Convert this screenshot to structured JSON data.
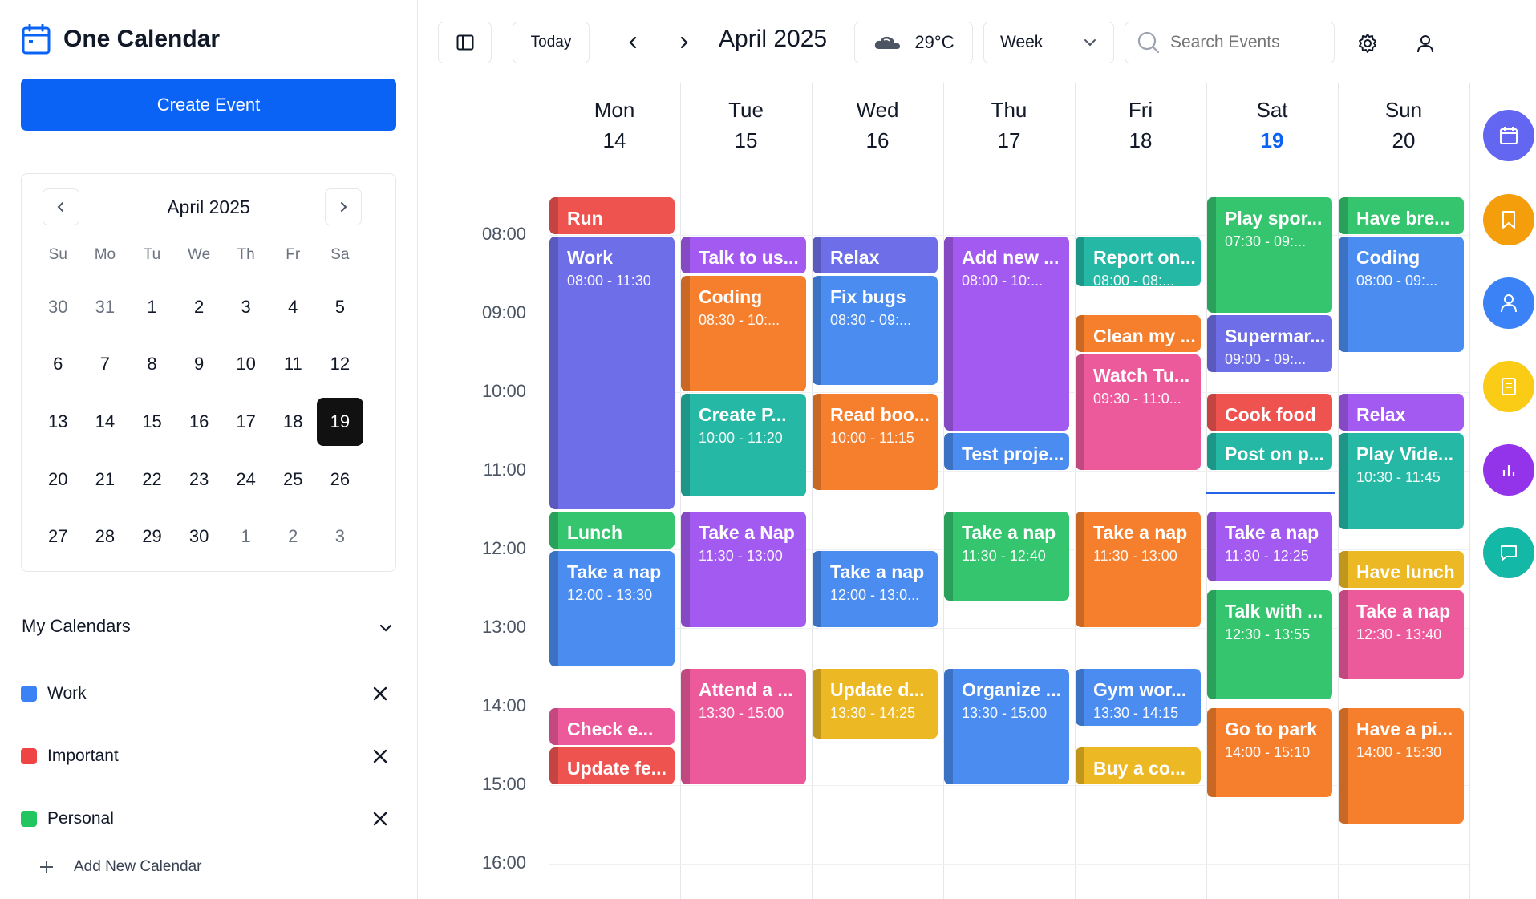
{
  "app": {
    "title": "One Calendar",
    "create_label": "Create Event"
  },
  "mini_calendar": {
    "title": "April 2025",
    "dow": [
      "Su",
      "Mo",
      "Tu",
      "We",
      "Th",
      "Fr",
      "Sa"
    ],
    "days": [
      {
        "d": "30",
        "muted": true
      },
      {
        "d": "31",
        "muted": true
      },
      {
        "d": "1"
      },
      {
        "d": "2"
      },
      {
        "d": "3"
      },
      {
        "d": "4"
      },
      {
        "d": "5"
      },
      {
        "d": "6"
      },
      {
        "d": "7"
      },
      {
        "d": "8"
      },
      {
        "d": "9"
      },
      {
        "d": "10"
      },
      {
        "d": "11"
      },
      {
        "d": "12"
      },
      {
        "d": "13"
      },
      {
        "d": "14"
      },
      {
        "d": "15"
      },
      {
        "d": "16"
      },
      {
        "d": "17"
      },
      {
        "d": "18"
      },
      {
        "d": "19",
        "selected": true
      },
      {
        "d": "20"
      },
      {
        "d": "21"
      },
      {
        "d": "22"
      },
      {
        "d": "23"
      },
      {
        "d": "24"
      },
      {
        "d": "25"
      },
      {
        "d": "26"
      },
      {
        "d": "27"
      },
      {
        "d": "28"
      },
      {
        "d": "29"
      },
      {
        "d": "30"
      },
      {
        "d": "1",
        "muted": true
      },
      {
        "d": "2",
        "muted": true
      },
      {
        "d": "3",
        "muted": true
      }
    ]
  },
  "my_calendars": {
    "title": "My Calendars",
    "items": [
      {
        "label": "Work",
        "color": "#3b82f6"
      },
      {
        "label": "Important",
        "color": "#ef4444"
      },
      {
        "label": "Personal",
        "color": "#22c55e"
      }
    ],
    "add_label": "Add New Calendar"
  },
  "toolbar": {
    "today_label": "Today",
    "title": "April 2025",
    "weather": "29°C",
    "view": "Week",
    "search_placeholder": "Search Events"
  },
  "week": {
    "days": [
      {
        "name": "Mon",
        "num": "14"
      },
      {
        "name": "Tue",
        "num": "15"
      },
      {
        "name": "Wed",
        "num": "16"
      },
      {
        "name": "Thu",
        "num": "17"
      },
      {
        "name": "Fri",
        "num": "18"
      },
      {
        "name": "Sat",
        "num": "19",
        "today": true
      },
      {
        "name": "Sun",
        "num": "20"
      }
    ],
    "times": [
      "08:00",
      "09:00",
      "10:00",
      "11:00",
      "12:00",
      "13:00",
      "14:00",
      "15:00",
      "16:00"
    ],
    "events": [
      {
        "day": 0,
        "start": "07:30",
        "end": "08:00",
        "title": "Run",
        "color": "#ef5350"
      },
      {
        "day": 0,
        "start": "08:00",
        "end": "11:30",
        "title": "Work",
        "time": "08:00 - 11:30",
        "color": "#6e6ee8"
      },
      {
        "day": 0,
        "start": "11:30",
        "end": "12:00",
        "title": "Lunch",
        "color": "#34c56e"
      },
      {
        "day": 0,
        "start": "12:00",
        "end": "13:30",
        "title": "Take a nap",
        "time": "12:00 - 13:30",
        "color": "#4a8cf0"
      },
      {
        "day": 0,
        "start": "14:00",
        "end": "14:30",
        "title": "Check e...",
        "color": "#ec5a9c"
      },
      {
        "day": 0,
        "start": "14:30",
        "end": "15:00",
        "title": "Update fe...",
        "color": "#ef5350"
      },
      {
        "day": 1,
        "start": "08:00",
        "end": "08:30",
        "title": "Talk to us...",
        "color": "#a35af0"
      },
      {
        "day": 1,
        "start": "08:30",
        "end": "10:00",
        "title": "Coding",
        "time": "08:30 - 10:...",
        "color": "#f57f2c"
      },
      {
        "day": 1,
        "start": "10:00",
        "end": "11:20",
        "title": "Create P...",
        "time": "10:00 - 11:20",
        "color": "#25b8a5"
      },
      {
        "day": 1,
        "start": "11:30",
        "end": "13:00",
        "title": "Take a Nap",
        "time": "11:30 - 13:00",
        "color": "#a35af0"
      },
      {
        "day": 1,
        "start": "13:30",
        "end": "15:00",
        "title": "Attend a ...",
        "time": "13:30 - 15:00",
        "color": "#ec5a9c"
      },
      {
        "day": 2,
        "start": "08:00",
        "end": "08:30",
        "title": "Relax",
        "color": "#6e6ee8"
      },
      {
        "day": 2,
        "start": "08:30",
        "end": "09:55",
        "title": "Fix bugs",
        "time": "08:30 - 09:...",
        "color": "#4a8cf0"
      },
      {
        "day": 2,
        "start": "10:00",
        "end": "11:15",
        "title": "Read boo...",
        "time": "10:00 - 11:15",
        "color": "#f57f2c"
      },
      {
        "day": 2,
        "start": "12:00",
        "end": "13:00",
        "title": "Take a nap",
        "time": "12:00 - 13:0...",
        "color": "#4a8cf0"
      },
      {
        "day": 2,
        "start": "13:30",
        "end": "14:25",
        "title": "Update d...",
        "time": "13:30 - 14:25",
        "color": "#ecb823"
      },
      {
        "day": 3,
        "start": "08:00",
        "end": "10:30",
        "title": "Add new ...",
        "time": "08:00 - 10:...",
        "color": "#a35af0"
      },
      {
        "day": 3,
        "start": "10:30",
        "end": "11:00",
        "title": "Test proje...",
        "color": "#4a8cf0"
      },
      {
        "day": 3,
        "start": "11:30",
        "end": "12:40",
        "title": "Take a nap",
        "time": "11:30 - 12:40",
        "color": "#34c56e"
      },
      {
        "day": 3,
        "start": "13:30",
        "end": "15:00",
        "title": "Organize ...",
        "time": "13:30 - 15:00",
        "color": "#4a8cf0"
      },
      {
        "day": 4,
        "start": "08:00",
        "end": "08:40",
        "title": "Report on...",
        "time": "08:00 - 08:...",
        "color": "#25b8a5"
      },
      {
        "day": 4,
        "start": "09:00",
        "end": "09:30",
        "title": "Clean my ...",
        "color": "#f57f2c"
      },
      {
        "day": 4,
        "start": "09:30",
        "end": "11:00",
        "title": "Watch Tu...",
        "time": "09:30 - 11:0...",
        "color": "#ec5a9c"
      },
      {
        "day": 4,
        "start": "11:30",
        "end": "13:00",
        "title": "Take a nap",
        "time": "11:30 - 13:00",
        "color": "#f57f2c"
      },
      {
        "day": 4,
        "start": "13:30",
        "end": "14:15",
        "title": "Gym wor...",
        "time": "13:30 - 14:15",
        "color": "#4a8cf0"
      },
      {
        "day": 4,
        "start": "14:30",
        "end": "15:00",
        "title": "Buy a co...",
        "color": "#ecb823"
      },
      {
        "day": 5,
        "start": "07:30",
        "end": "09:00",
        "title": "Play spor...",
        "time": "07:30 - 09:...",
        "color": "#34c56e"
      },
      {
        "day": 5,
        "start": "09:00",
        "end": "09:45",
        "title": "Supermar...",
        "time": "09:00 - 09:...",
        "color": "#6e6ee8"
      },
      {
        "day": 5,
        "start": "10:00",
        "end": "10:30",
        "title": "Cook food",
        "color": "#ef5350"
      },
      {
        "day": 5,
        "start": "10:30",
        "end": "11:00",
        "title": "Post on p...",
        "color": "#25b8a5"
      },
      {
        "day": 5,
        "start": "11:30",
        "end": "12:25",
        "title": "Take a nap",
        "time": "11:30 - 12:25",
        "color": "#a35af0"
      },
      {
        "day": 5,
        "start": "12:30",
        "end": "13:55",
        "title": "Talk with ...",
        "time": "12:30 - 13:55",
        "color": "#34c56e"
      },
      {
        "day": 5,
        "start": "14:00",
        "end": "15:10",
        "title": "Go to park",
        "time": "14:00 - 15:10",
        "color": "#f57f2c"
      },
      {
        "day": 6,
        "start": "07:30",
        "end": "08:00",
        "title": "Have bre...",
        "color": "#34c56e"
      },
      {
        "day": 6,
        "start": "08:00",
        "end": "09:30",
        "title": "Coding",
        "time": "08:00 - 09:...",
        "color": "#4a8cf0"
      },
      {
        "day": 6,
        "start": "10:00",
        "end": "10:30",
        "title": "Relax",
        "color": "#a35af0"
      },
      {
        "day": 6,
        "start": "10:30",
        "end": "11:45",
        "title": "Play Vide...",
        "time": "10:30 - 11:45",
        "color": "#25b8a5"
      },
      {
        "day": 6,
        "start": "12:00",
        "end": "12:30",
        "title": "Have lunch",
        "color": "#ecb823"
      },
      {
        "day": 6,
        "start": "12:30",
        "end": "13:40",
        "title": "Take a nap",
        "time": "12:30 - 13:40",
        "color": "#ec5a9c"
      },
      {
        "day": 6,
        "start": "14:00",
        "end": "15:30",
        "title": "Have a pi...",
        "time": "14:00 - 15:30",
        "color": "#f57f2c"
      }
    ]
  },
  "rail": [
    {
      "name": "calendar-icon",
      "color": "#6366f1"
    },
    {
      "name": "bookmark-icon",
      "color": "#f59e0b"
    },
    {
      "name": "user-icon",
      "color": "#3b82f6"
    },
    {
      "name": "notes-icon",
      "color": "#facc15"
    },
    {
      "name": "chart-icon",
      "color": "#9333ea"
    },
    {
      "name": "chat-icon",
      "color": "#14b8a6"
    }
  ]
}
